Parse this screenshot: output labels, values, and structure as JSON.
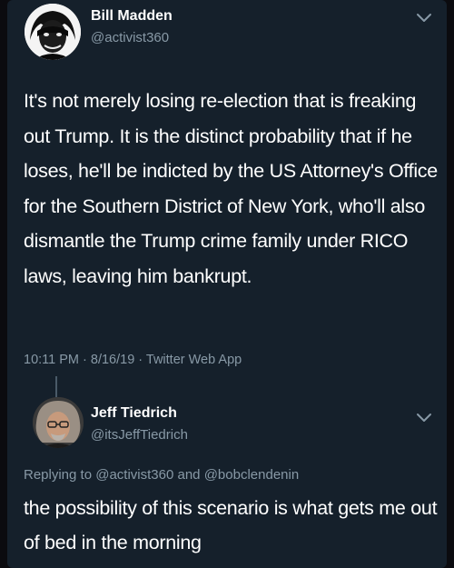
{
  "main_tweet": {
    "display_name": "Bill Madden",
    "handle": "@activist360",
    "text": "It's not merely losing re-election that is freaking out Trump. It is the distinct probability that if he loses, he'll be indicted by the US Attorney's Office for the Southern District of New York, who'll also dismantle the Trump crime family under RICO laws, leaving him bankrupt.",
    "timestamp": "10:11 PM · 8/16/19",
    "separator": " · ",
    "source_app": "Twitter Web App"
  },
  "reply_tweet": {
    "display_name": "Jeff Tiedrich",
    "handle": "@itsJeffTiedrich",
    "replying_prefix": "Replying to",
    "replying_to_1": "@activist360",
    "replying_and": "and",
    "replying_to_2": "@bobclendenin",
    "text": "the possibility of this scenario is what gets me out of bed in the morning"
  },
  "icons": {
    "menu": "chevron-down-icon",
    "main_avatar": "avatar-portrait",
    "reply_avatar": "avatar-portrait"
  },
  "colors": {
    "background": "#15202b",
    "primary_text": "#ffffff",
    "secondary_text": "#8899a6",
    "thread_line": "#4a5a68"
  }
}
